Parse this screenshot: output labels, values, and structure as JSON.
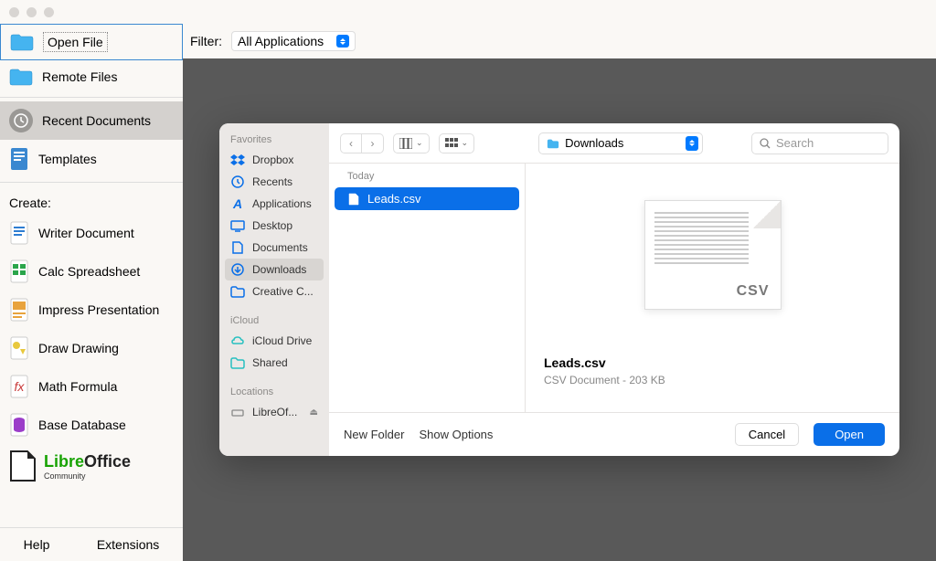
{
  "sidebar": {
    "open_file": "Open File",
    "remote_files": "Remote Files",
    "recent_documents": "Recent Documents",
    "templates": "Templates",
    "create_label": "Create:",
    "writer": "Writer Document",
    "calc": "Calc Spreadsheet",
    "impress": "Impress Presentation",
    "draw": "Draw Drawing",
    "math": "Math Formula",
    "base": "Base Database",
    "logo_main": "LibreOffice",
    "logo_sub": "Community",
    "help": "Help",
    "extensions": "Extensions"
  },
  "filter": {
    "label": "Filter:",
    "value": "All Applications"
  },
  "dialog": {
    "favorites_label": "Favorites",
    "favorites": [
      {
        "icon": "dropbox",
        "label": "Dropbox"
      },
      {
        "icon": "recents",
        "label": "Recents"
      },
      {
        "icon": "apps",
        "label": "Applications"
      },
      {
        "icon": "desktop",
        "label": "Desktop"
      },
      {
        "icon": "documents",
        "label": "Documents"
      },
      {
        "icon": "downloads",
        "label": "Downloads"
      },
      {
        "icon": "folder",
        "label": "Creative C..."
      }
    ],
    "icloud_label": "iCloud",
    "icloud": [
      {
        "icon": "cloud",
        "label": "iCloud Drive"
      },
      {
        "icon": "shared",
        "label": "Shared"
      }
    ],
    "locations_label": "Locations",
    "locations": [
      {
        "icon": "disk",
        "label": "LibreOf..."
      }
    ],
    "location_current": "Downloads",
    "search_placeholder": "Search",
    "group_label": "Today",
    "files": [
      {
        "name": "Leads.csv"
      }
    ],
    "preview": {
      "name": "Leads.csv",
      "meta": "CSV Document - 203 KB",
      "badge": "CSV"
    },
    "footer": {
      "new_folder": "New Folder",
      "show_options": "Show Options",
      "cancel": "Cancel",
      "open": "Open"
    }
  },
  "colors": {
    "accent": "#0a6fe8",
    "folder_blue": "#45b4f0"
  }
}
